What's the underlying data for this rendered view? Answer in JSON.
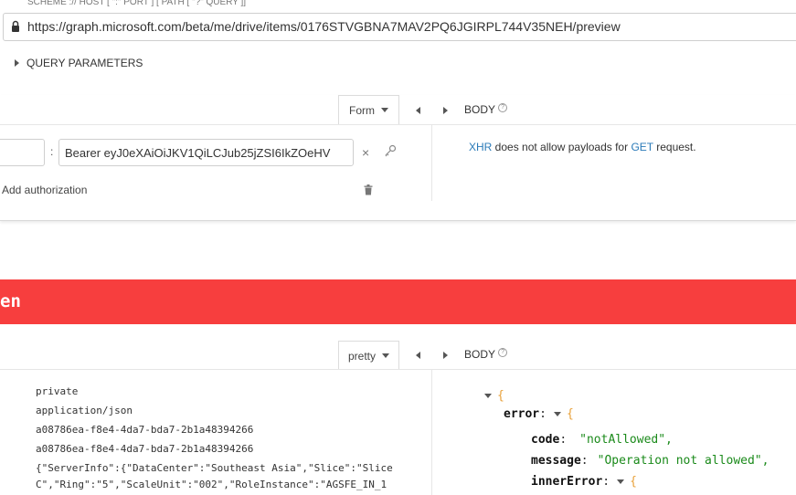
{
  "request": {
    "scheme_hint": "SCHEME :// HOST [ \":\" PORT ] [ PATH [ \"?\" QUERY ]]",
    "url": "https://graph.microsoft.com/beta/me/drive/items/0176STVGBNA7MAV2PQ6JGIRPL744V35NEH/preview",
    "query_parameters_label": "QUERY PARAMETERS",
    "headers_mode": "Form",
    "header_separator": ":",
    "header_key": "",
    "header_value": "Bearer eyJ0eXAiOiJKV1QiLCJub25jZSI6IkZOeHV",
    "add_authorization_label": "Add authorization",
    "body_label": "BODY",
    "body_help": "?",
    "body_message": {
      "xhr": "XHR",
      "text1": " does not allow payloads for ",
      "method": "GET",
      "text2": " request."
    }
  },
  "response": {
    "status_text": "en",
    "body_mode": "pretty",
    "body_label": "BODY",
    "body_help": "?",
    "header_values": [
      "private",
      "application/json",
      "a08786ea-f8e4-4da7-bda7-2b1a48394266",
      "a08786ea-f8e4-4da7-bda7-2b1a48394266",
      "{\"ServerInfo\":{\"DataCenter\":\"Southeast Asia\",\"Slice\":\"Slice",
      "C\",\"Ring\":\"5\",\"ScaleUnit\":\"002\",\"RoleInstance\":\"AGSFE_IN_1"
    ],
    "json": {
      "root_brace": "{",
      "error_key": "error",
      "error_brace": "{",
      "code_key": "code",
      "code_value": "\"notAllowed\",",
      "message_key": "message",
      "message_value": "\"Operation not allowed\",",
      "inner_key": "innerError",
      "inner_brace": "{"
    }
  },
  "colors": {
    "status_error": "#f73e3e",
    "json_string": "#1a8a1a",
    "json_brace": "#e8a13a",
    "link": "#2a7ab8"
  },
  "icons": [
    "lock-icon",
    "chevron-right-icon",
    "caret-down-icon",
    "chevron-left-icon",
    "help-icon",
    "close-icon",
    "key-icon",
    "trash-icon"
  ]
}
